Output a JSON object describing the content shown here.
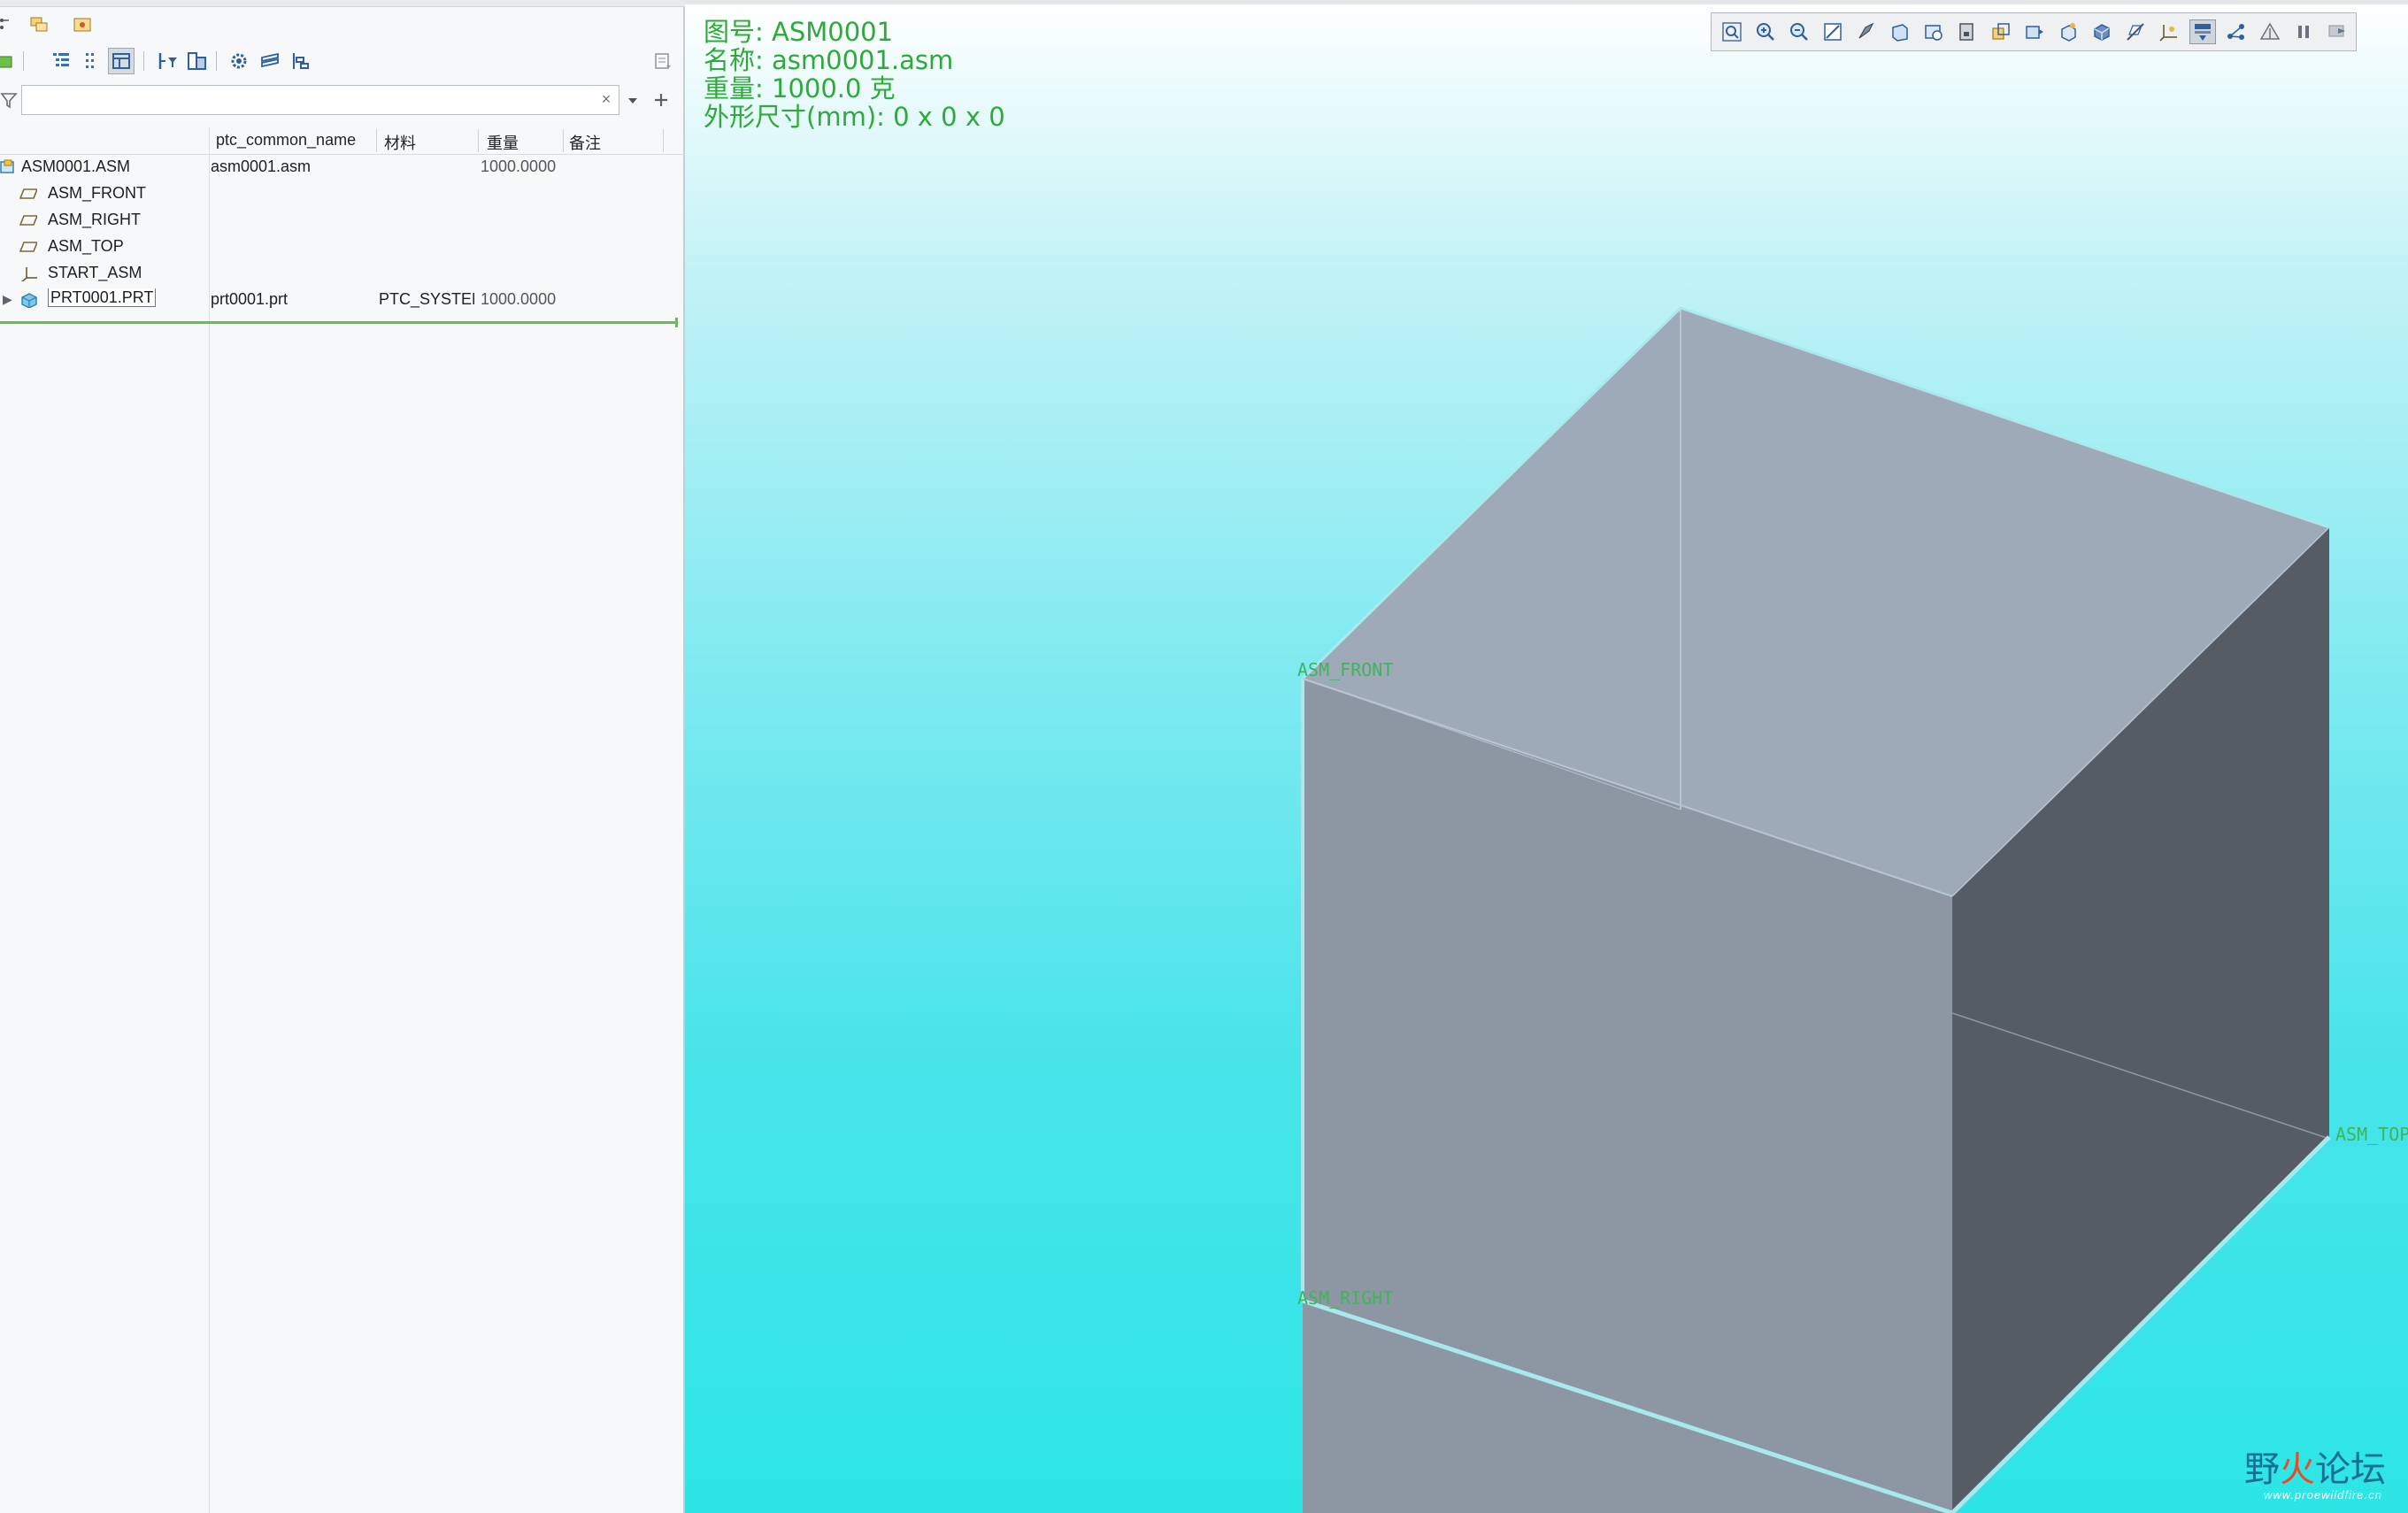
{
  "model_tree": {
    "search": {
      "value": "",
      "placeholder": "",
      "clear_glyph": "×"
    },
    "columns": [
      "ptc_common_name",
      "材料",
      "重量",
      "备注"
    ],
    "rows": [
      {
        "name": "ASM0001.ASM",
        "common_name": "asm0001.asm",
        "material": "",
        "weight": "1000.0000",
        "icon": "assembly-icon"
      },
      {
        "name": "ASM_FRONT",
        "common_name": "",
        "material": "",
        "weight": "",
        "icon": "datum-plane-icon"
      },
      {
        "name": "ASM_RIGHT",
        "common_name": "",
        "material": "",
        "weight": "",
        "icon": "datum-plane-icon"
      },
      {
        "name": "ASM_TOP",
        "common_name": "",
        "material": "",
        "weight": "",
        "icon": "datum-plane-icon"
      },
      {
        "name": "START_ASM",
        "common_name": "",
        "material": "",
        "weight": "",
        "icon": "coordinate-system-icon"
      },
      {
        "name": "PRT0001.PRT",
        "common_name": "prt0001.prt",
        "material": "PTC_SYSTEM",
        "weight": "1000.0000",
        "icon": "part-icon",
        "expander": "▶"
      }
    ]
  },
  "viewport": {
    "info": {
      "drawing_no": "图号: ASM0001",
      "name": "名称: asm0001.asm",
      "weight": "重量: 1000.0 克",
      "dimensions": "外形尺寸(mm): 0 x 0 x 0"
    },
    "datum_labels": {
      "front": "ASM_FRONT",
      "right": "ASM_RIGHT",
      "top": "ASM_TOP"
    },
    "toolbar_icons": [
      "refit-icon",
      "zoom-in-icon",
      "zoom-out-icon",
      "repaint-icon",
      "shading-icon",
      "view-icon",
      "saved-views-icon",
      "perspective-icon",
      "section-icon",
      "display-style-icon",
      "spin-center-icon",
      "plane-display-icon",
      "axis-display-icon",
      "csys-display-icon",
      "point-display-icon",
      "annotation-display-icon",
      "tree-display-icon",
      "pause-icon",
      "next-icon"
    ]
  },
  "watermark": {
    "text_part1": "野",
    "text_fire": "火",
    "text_part2": "论坛",
    "url": "www.proewildfire.cn"
  },
  "colors": {
    "info_text": "#2eaa3a",
    "datum_text": "#3fb55a",
    "cube_top": "#9eaab8",
    "cube_front": "#8d96a3",
    "cube_right": "#565c66"
  }
}
